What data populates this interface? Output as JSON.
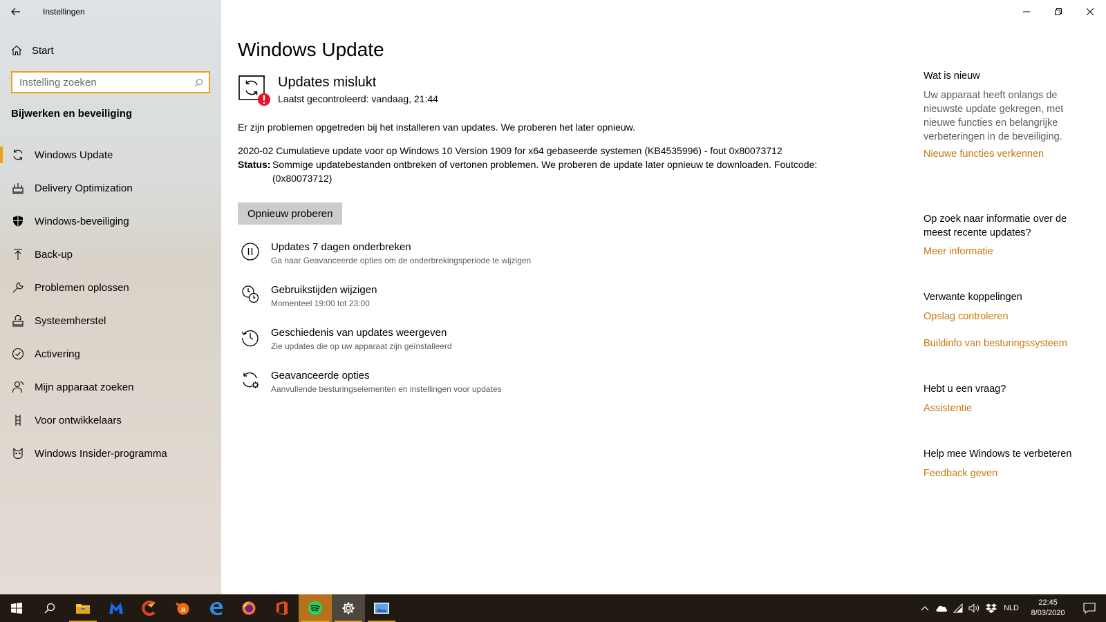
{
  "window": {
    "app_title": "Instellingen",
    "back_icon": "back-arrow-icon",
    "controls": [
      "minimize-icon",
      "restore-icon",
      "close-icon"
    ]
  },
  "sidebar": {
    "home_label": "Start",
    "search": {
      "placeholder": "Instelling zoeken"
    },
    "section_title": "Bijwerken en beveiliging",
    "items": [
      {
        "label": "Windows Update",
        "icon": "sync-icon",
        "active": true
      },
      {
        "label": "Delivery Optimization",
        "icon": "delivery-icon"
      },
      {
        "label": "Windows-beveiliging",
        "icon": "shield-icon"
      },
      {
        "label": "Back-up",
        "icon": "upload-arrow-icon"
      },
      {
        "label": "Problemen oplossen",
        "icon": "wrench-icon"
      },
      {
        "label": "Systeemherstel",
        "icon": "recovery-icon"
      },
      {
        "label": "Activering",
        "icon": "check-circle-icon"
      },
      {
        "label": "Mijn apparaat zoeken",
        "icon": "person-locate-icon"
      },
      {
        "label": "Voor ontwikkelaars",
        "icon": "developer-icon"
      },
      {
        "label": "Windows Insider-programma",
        "icon": "insider-cat-icon"
      }
    ]
  },
  "main": {
    "title": "Windows Update",
    "status": {
      "title": "Updates mislukt",
      "subtitle": "Laatst gecontroleerd: vandaag, 21:44"
    },
    "problem_text": "Er zijn problemen opgetreden bij het installeren van updates. We proberen het later opnieuw.",
    "update_name": "2020-02 Cumulatieve update voor op Windows 10 Version 1909 for x64 gebaseerde systemen (KB4535996) - fout 0x80073712",
    "status_label": "Status:",
    "status_value": "Sommige updatebestanden ontbreken of vertonen problemen. We proberen de update later opnieuw te downloaden. Foutcode: (0x80073712)",
    "retry_label": "Opnieuw proberen",
    "options": [
      {
        "title": "Updates 7 dagen onderbreken",
        "subtitle": "Ga naar Geavanceerde opties om de onderbrekingsperiode te wijzigen",
        "icon": "pause-icon"
      },
      {
        "title": "Gebruikstijden wijzigen",
        "subtitle": "Momenteel 19:00 tot 23:00",
        "icon": "active-hours-clock-icon"
      },
      {
        "title": "Geschiedenis van updates weergeven",
        "subtitle": "Zie updates die op uw apparaat zijn geïnstalleerd",
        "icon": "history-icon"
      },
      {
        "title": "Geavanceerde opties",
        "subtitle": "Aanvullende besturingselementen en instellingen voor updates",
        "icon": "advanced-sync-gear-icon"
      }
    ]
  },
  "right_panel": {
    "whats_new": {
      "heading": "Wat is nieuw",
      "text": "Uw apparaat heeft onlangs de nieuwste update gekregen, met nieuwe functies en belangrijke verbeteringen in de beveiliging.",
      "link": "Nieuwe functies verkennen"
    },
    "info": {
      "heading": "Op zoek naar informatie over de meest recente updates?",
      "link": "Meer informatie"
    },
    "related": {
      "heading": "Verwante koppelingen",
      "links": [
        "Opslag controleren",
        "Buildinfo van besturingssysteem"
      ]
    },
    "question": {
      "heading": "Hebt u een vraag?",
      "link": "Assistentie"
    },
    "improve": {
      "heading": "Help mee Windows te verbeteren",
      "link": "Feedback geven"
    },
    "accent_color": "#c4780d"
  },
  "taskbar": {
    "apps": [
      "start-icon",
      "search-icon",
      "file-explorer-icon",
      "malwarebytes-icon",
      "ccleaner-icon",
      "avast-icon",
      "edge-icon",
      "firefox-icon",
      "office-icon",
      "spotify-icon",
      "settings-gear-icon",
      "photos-icon"
    ],
    "language": "NLD",
    "time": "22:45",
    "date": "8/03/2020"
  }
}
